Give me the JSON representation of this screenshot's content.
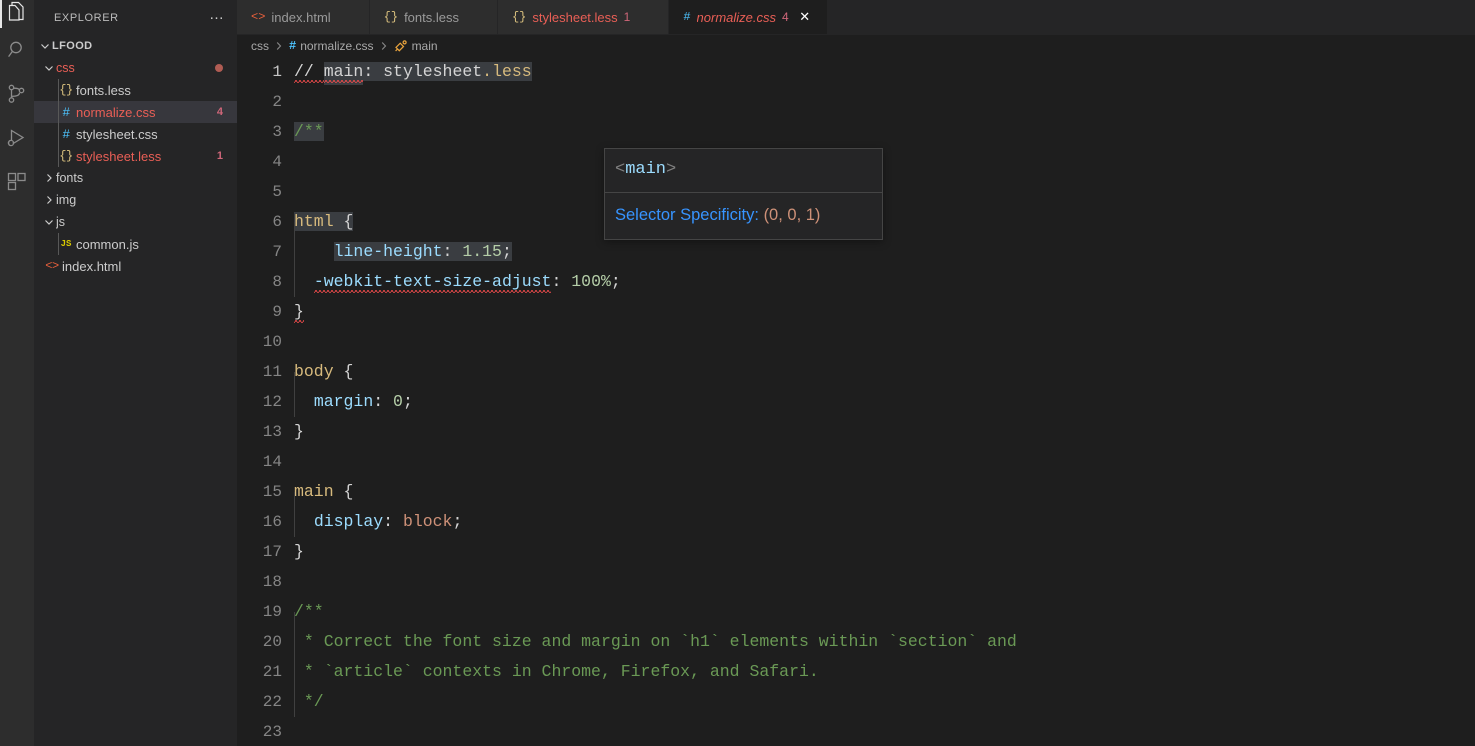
{
  "activity_bar": {
    "items": [
      {
        "name": "explorer",
        "icon": "files-icon",
        "active": true
      },
      {
        "name": "search",
        "icon": "search-icon",
        "active": false
      },
      {
        "name": "source-control",
        "icon": "source-control-icon",
        "active": false
      },
      {
        "name": "run-debug",
        "icon": "run-and-debug-icon",
        "active": false
      },
      {
        "name": "extensions",
        "icon": "extensions-icon",
        "active": false
      }
    ]
  },
  "sidebar": {
    "title": "EXPLORER",
    "more_actions_label": "…",
    "root": {
      "label": "LFOOD",
      "expanded": true
    },
    "items": [
      {
        "label": "css",
        "kind": "folder",
        "indent": 1,
        "expanded": true,
        "error": true,
        "dot": true,
        "icon": "chevron-down-icon"
      },
      {
        "label": "fonts.less",
        "kind": "file",
        "indent": 2,
        "icon": "less-file-icon",
        "icon_text": "{}"
      },
      {
        "label": "normalize.css",
        "kind": "file",
        "indent": 2,
        "icon": "css-file-icon",
        "icon_text": "#",
        "error": true,
        "badge": "4",
        "selected": true
      },
      {
        "label": "stylesheet.css",
        "kind": "file",
        "indent": 2,
        "icon": "css-file-icon",
        "icon_text": "#"
      },
      {
        "label": "stylesheet.less",
        "kind": "file",
        "indent": 2,
        "icon": "less-file-icon",
        "icon_text": "{}",
        "error": true,
        "badge": "1"
      },
      {
        "label": "fonts",
        "kind": "folder",
        "indent": 1,
        "expanded": false,
        "icon": "chevron-right-icon"
      },
      {
        "label": "img",
        "kind": "folder",
        "indent": 1,
        "expanded": false,
        "icon": "chevron-right-icon"
      },
      {
        "label": "js",
        "kind": "folder",
        "indent": 1,
        "expanded": true,
        "icon": "chevron-down-icon"
      },
      {
        "label": "common.js",
        "kind": "file",
        "indent": 2,
        "icon": "js-file-icon",
        "icon_text": "JS"
      },
      {
        "label": "index.html",
        "kind": "file",
        "indent": 1,
        "icon": "html-file-icon",
        "icon_text": "<>"
      }
    ]
  },
  "tabs": [
    {
      "label": "index.html",
      "icon": "html-file-icon",
      "icon_text": "<>",
      "active": false,
      "error_count": ""
    },
    {
      "label": "fonts.less",
      "icon": "less-file-icon",
      "icon_text": "{}",
      "active": false,
      "error_count": ""
    },
    {
      "label": "stylesheet.less",
      "icon": "less-file-icon",
      "icon_text": "{}",
      "active": false,
      "error_count": "1",
      "error": true
    },
    {
      "label": "normalize.css",
      "icon": "css-file-icon",
      "icon_text": "#",
      "active": true,
      "error_count": "4",
      "error": true,
      "close_label": "✕"
    }
  ],
  "breadcrumbs": [
    {
      "label": "css",
      "icon": ""
    },
    {
      "label": "normalize.css",
      "icon": "css-file-icon",
      "icon_text": "#"
    },
    {
      "label": "main",
      "icon": "css-selector-icon"
    }
  ],
  "breadcrumb_separator": "❯",
  "hover_popup": {
    "code_open": "<",
    "code_name": "main",
    "code_close": ">",
    "label": "Selector Specificity",
    "separator": ": ",
    "value": "(0, 0, 1)"
  },
  "editor": {
    "language": "css",
    "active_line": 1,
    "lines": [
      {
        "n": "1",
        "tokens": [
          {
            "t": "// ",
            "c": "t-plain squig"
          },
          {
            "t": "main",
            "c": "t-plain hl squig"
          },
          {
            "t": ": ",
            "c": "t-plain hl"
          },
          {
            "t": "stylesheet",
            "c": "t-plain hl"
          },
          {
            "t": ".less",
            "c": "t-lessfile hl"
          }
        ]
      },
      {
        "n": "2",
        "tokens": []
      },
      {
        "n": "3",
        "tokens": [
          {
            "t": "/**",
            "c": "t-cmt hl"
          }
        ]
      },
      {
        "n": "4",
        "tokens": []
      },
      {
        "n": "5",
        "tokens": []
      },
      {
        "n": "6",
        "tokens": [
          {
            "t": "html ",
            "c": "t-sel hl"
          },
          {
            "t": "{",
            "c": "t-punc hl"
          }
        ]
      },
      {
        "n": "7",
        "tokens": [
          {
            "t": "    ",
            "c": "t-plain"
          },
          {
            "t": "line-height",
            "c": "t-prop hl"
          },
          {
            "t": ": ",
            "c": "t-punc hl"
          },
          {
            "t": "1.15",
            "c": "t-num hl"
          },
          {
            "t": ";",
            "c": "t-punc hl"
          }
        ]
      },
      {
        "n": "8",
        "tokens": [
          {
            "t": "  ",
            "c": "t-plain"
          },
          {
            "t": "-webkit-text-size-adjust",
            "c": "t-prop squig"
          },
          {
            "t": ": ",
            "c": "t-punc"
          },
          {
            "t": "100%",
            "c": "t-num"
          },
          {
            "t": ";",
            "c": "t-punc"
          }
        ]
      },
      {
        "n": "9",
        "tokens": [
          {
            "t": "}",
            "c": "t-punc squig"
          }
        ]
      },
      {
        "n": "10",
        "tokens": []
      },
      {
        "n": "11",
        "tokens": [
          {
            "t": "body ",
            "c": "t-sel"
          },
          {
            "t": "{",
            "c": "t-punc"
          }
        ]
      },
      {
        "n": "12",
        "tokens": [
          {
            "t": "  ",
            "c": "t-plain"
          },
          {
            "t": "margin",
            "c": "t-prop"
          },
          {
            "t": ": ",
            "c": "t-punc"
          },
          {
            "t": "0",
            "c": "t-num"
          },
          {
            "t": ";",
            "c": "t-punc"
          }
        ]
      },
      {
        "n": "13",
        "tokens": [
          {
            "t": "}",
            "c": "t-punc"
          }
        ]
      },
      {
        "n": "14",
        "tokens": []
      },
      {
        "n": "15",
        "tokens": [
          {
            "t": "main ",
            "c": "t-sel"
          },
          {
            "t": "{",
            "c": "t-punc"
          }
        ]
      },
      {
        "n": "16",
        "tokens": [
          {
            "t": "  ",
            "c": "t-plain"
          },
          {
            "t": "display",
            "c": "t-prop"
          },
          {
            "t": ": ",
            "c": "t-punc"
          },
          {
            "t": "block",
            "c": "t-val"
          },
          {
            "t": ";",
            "c": "t-punc"
          }
        ]
      },
      {
        "n": "17",
        "tokens": [
          {
            "t": "}",
            "c": "t-punc"
          }
        ]
      },
      {
        "n": "18",
        "tokens": []
      },
      {
        "n": "19",
        "tokens": [
          {
            "t": "/**",
            "c": "t-cmt"
          }
        ]
      },
      {
        "n": "20",
        "tokens": [
          {
            "t": " * Correct the font size and margin on `h1` elements within `section` and",
            "c": "t-cmt"
          }
        ]
      },
      {
        "n": "21",
        "tokens": [
          {
            "t": " * `article` contexts in Chrome, Firefox, and Safari.",
            "c": "t-cmt"
          }
        ]
      },
      {
        "n": "22",
        "tokens": [
          {
            "t": " */",
            "c": "t-cmt"
          }
        ]
      },
      {
        "n": "23",
        "tokens": []
      }
    ]
  },
  "colors": {
    "editor_bg": "#1e1e1e",
    "sidebar_bg": "#252526",
    "activity_bg": "#2d2d2d",
    "selection_hl": "#3a3d41",
    "error_red": "#f14c4c",
    "error_text": "#e95f56",
    "link_blue": "#3794ff",
    "comment_green": "#6a9955",
    "selector_gold": "#d7ba7d",
    "property_blue": "#9cdcfe",
    "number_green": "#b5cea8",
    "value_orange": "#ce9178"
  }
}
